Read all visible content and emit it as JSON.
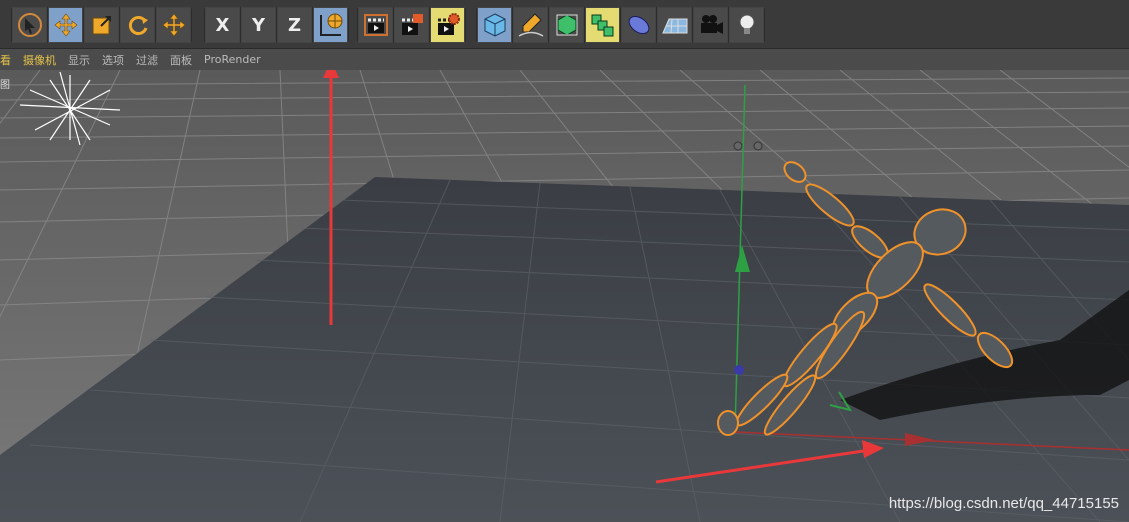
{
  "toolbar": {
    "tools": [
      {
        "name": "live-selection",
        "icon": "select-cursor-icon",
        "active": false
      },
      {
        "name": "move",
        "icon": "move-arrows-icon",
        "active": true
      },
      {
        "name": "scale",
        "icon": "scale-icon",
        "active": false
      },
      {
        "name": "rotate",
        "icon": "rotate-icon",
        "active": false
      },
      {
        "name": "recent-tool",
        "icon": "move-arrows-icon",
        "active": false
      }
    ],
    "axis_x": "X",
    "axis_y": "Y",
    "axis_z": "Z",
    "coordinate_system_icon": "world-coordinate-icon"
  },
  "menu": {
    "items": [
      "看",
      "摄像机",
      "显示",
      "选项",
      "过滤",
      "面板",
      "ProRender"
    ],
    "highlighted": [
      "看",
      "摄像机"
    ]
  },
  "viewport": {
    "label": "图",
    "accent_colors": {
      "x_axis": "#c8302c",
      "y_axis": "#2ea044",
      "selection": "#f0922a",
      "annotation_arrow": "#e8383a"
    }
  },
  "watermark": "https://blog.csdn.net/qq_44715155"
}
